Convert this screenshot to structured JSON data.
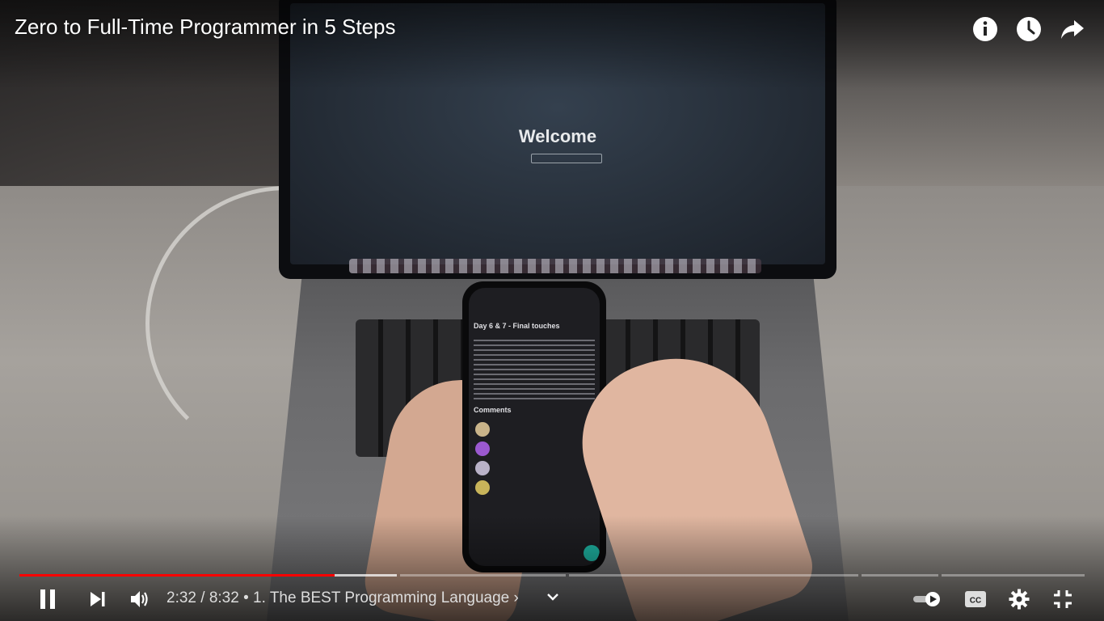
{
  "video": {
    "title": "Zero to Full-Time Programmer in 5 Steps"
  },
  "screen_content": {
    "laptop_heading": "Welcome",
    "phone_post_title": "Day 6 & 7 - Final touches",
    "phone_comments_heading": "Comments"
  },
  "top_actions": {
    "info_icon": "info-icon",
    "watch_later_icon": "clock-icon",
    "share_icon": "share-icon"
  },
  "progress": {
    "played_fraction": 0.296,
    "buffered_fraction": 0.354,
    "played_color": "#ff0000"
  },
  "controls": {
    "current_time": "2:32",
    "duration": "8:32",
    "separator": " / ",
    "bullet": " • ",
    "chapter": "1. The BEST Programming Language",
    "chapter_arrow": "›",
    "autoplay": true
  },
  "colors": {
    "accent": "#ff0000",
    "control_text": "#dddddd"
  }
}
